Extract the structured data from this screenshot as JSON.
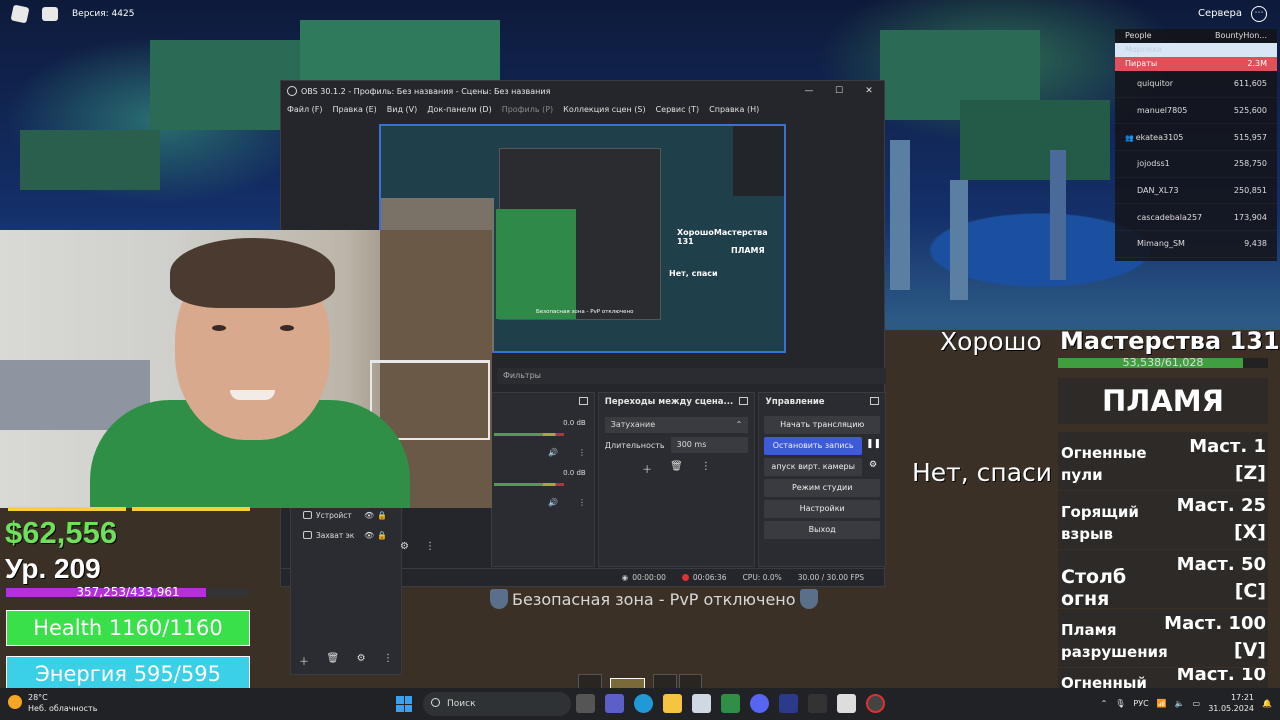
{
  "topbar": {
    "version": "Версия: 4425",
    "servers": "Сервера"
  },
  "leaderboard": {
    "col_people": "People",
    "col_bounty": "BountyHon...",
    "team_marines": "Морпехи",
    "team_pirates": "Пираты",
    "team_pirates_value": "2.3M",
    "rows": [
      {
        "name": "quiquitor",
        "value": "611,605"
      },
      {
        "name": "manuel7805",
        "value": "525,600"
      },
      {
        "name": "ekatea3105",
        "value": "515,957"
      },
      {
        "name": "jojodss1",
        "value": "258,750"
      },
      {
        "name": "DAN_XL73",
        "value": "250,851"
      },
      {
        "name": "cascadebala257",
        "value": "173,904"
      },
      {
        "name": "Mimang_SM",
        "value": "9,438"
      }
    ]
  },
  "obs": {
    "title": "OBS 30.1.2 - Профиль: Без названия - Сцены: Без названия",
    "menu": [
      "Файл (F)",
      "Правка (E)",
      "Вид (V)",
      "Док-панели (D)",
      "Профиль (P)",
      "Коллекция сцен (S)",
      "Сервис (T)",
      "Справка (H)"
    ],
    "filters": "Фильтры",
    "preview": {
      "mastery": "ХорошоМастерства 131",
      "fruit": "ПЛАМЯ",
      "no_thanks": "Нет, спаси",
      "safe": "Безопасная зона - PvP отключено"
    },
    "mixer": {
      "db1": "0.0 dB",
      "db2": "0.0 dB"
    },
    "transitions": {
      "title": "Переходы между сцена...",
      "select": "Затухание",
      "duration_label": "Длительность",
      "duration_value": "300 ms"
    },
    "controls": {
      "title": "Управление",
      "start_stream": "Начать трансляцию",
      "stop_record": "Остановить запись",
      "virtual_cam": "апуск вирт. камеры",
      "studio_mode": "Режим студии",
      "settings": "Настройки",
      "exit": "Выход"
    },
    "sources": [
      {
        "label": "Устройст"
      },
      {
        "label": "Захват эк"
      }
    ],
    "status": {
      "stream_time": "00:00:00",
      "rec_time": "00:06:36",
      "cpu": "CPU: 0.0%",
      "fps": "30.00 / 30.00 FPS"
    }
  },
  "hud": {
    "money": "$62,556",
    "level": "Ур. 209",
    "xp": "357,253/433,961",
    "xp_fraction": 0.82,
    "health": "Health 1160/1160",
    "energy": "Энергия 595/595"
  },
  "skills": {
    "mastery_prefix": "Хорошо",
    "mastery": "Мастерства 131",
    "mastery_progress": "53,538/61,028",
    "mastery_fraction": 0.88,
    "fruit": "ПЛАМЯ",
    "no_thanks": "Нет, спаси",
    "list": [
      {
        "name": "Огненные пули",
        "mast": "Маст. 1",
        "key": "[Z]"
      },
      {
        "name": "Горящий взрыв",
        "mast": "Маст. 25",
        "key": "[X]"
      },
      {
        "name": "Столб огня",
        "mast": "Маст. 50",
        "key": "[C]"
      },
      {
        "name": "Пламя разрушения",
        "mast": "Маст. 100",
        "key": "[V]"
      },
      {
        "name": "Огненный",
        "mast": "Маст. 10",
        "key": ""
      }
    ]
  },
  "safe_zone": "Безопасная зона - PvP отключено",
  "taskbar": {
    "temp": "28°C",
    "weather": "Неб. облачность",
    "search": "Поиск",
    "lang": "РУС",
    "time": "17:21",
    "date": "31.05.2024"
  }
}
